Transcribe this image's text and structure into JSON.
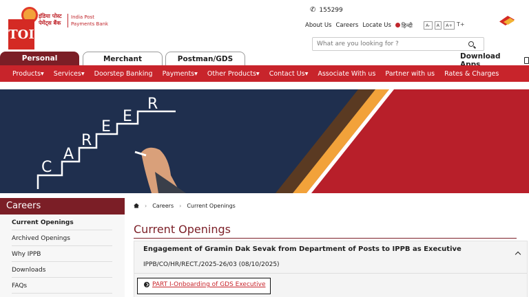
{
  "toi_badge": "TOI",
  "brand": {
    "hindi_line1": "इंडिया पोस्ट",
    "hindi_line2": "पेमेंट्स बैंक",
    "english_line1": "India Post",
    "english_line2": "Payments Bank"
  },
  "helpline": "155299",
  "top_links": {
    "about": "About Us",
    "careers": "Careers",
    "locate": "Locate Us",
    "hindi": "हिन्दी",
    "font_small": "A-",
    "font_normal": "A",
    "font_large": "A+",
    "theme": "T+"
  },
  "search": {
    "placeholder": "What are you looking for ?"
  },
  "download_apps": "Download Apps",
  "tabs": [
    {
      "label": "Personal",
      "active": true
    },
    {
      "label": "Merchant",
      "active": false
    },
    {
      "label": "Postman/GDS",
      "active": false
    }
  ],
  "nav": [
    "Products▾",
    "Services▾",
    "Doorstep Banking",
    "Payments▾",
    "Other Products▾",
    "Contact Us▾",
    "Associate With us",
    "Partner with us",
    "Rates & Charges"
  ],
  "banner": {
    "letters": [
      "C",
      "A",
      "R",
      "E",
      "E",
      "R"
    ]
  },
  "sidebar": {
    "title": "Careers",
    "items": [
      "Current Openings",
      "Archived Openings",
      "Why IPPB",
      "Downloads",
      "FAQs"
    ]
  },
  "breadcrumb": {
    "item1": "Careers",
    "item2": "Current Openings"
  },
  "main": {
    "title": "Current Openings",
    "accordion": {
      "title": "Engagement of Gramin Dak Sevak from Department of Posts to IPPB as Executive",
      "ref": "IPPB/CO/HR/RECT./2025-26/03 (08/10/2025)",
      "link": "PART I-Onboarding of GDS Executive"
    }
  },
  "colors": {
    "brand_red": "#c8242b",
    "maroon": "#7b1e26",
    "navy": "#1f2f4e",
    "accent": "#f2a23a"
  }
}
